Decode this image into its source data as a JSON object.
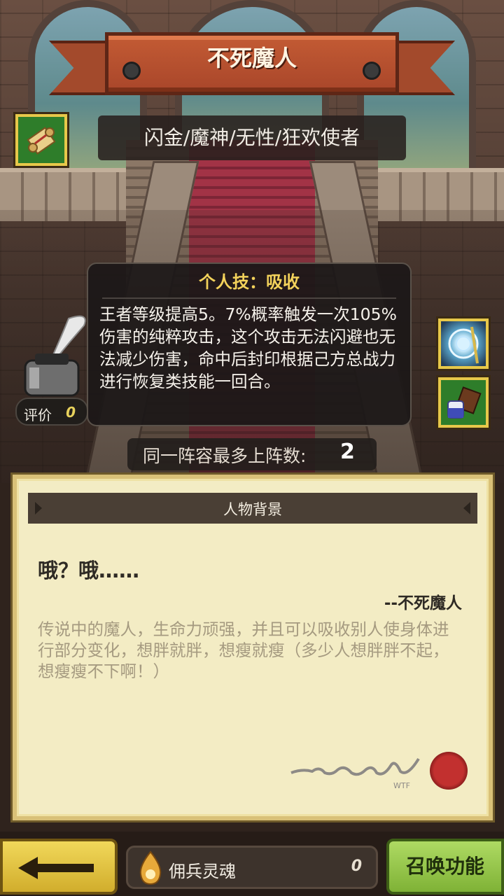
{
  "hero": {
    "name": "不死魔人",
    "tags": "闪金/魔神/无性/狂欢使者"
  },
  "skill": {
    "title": "个人技：吸收",
    "description": "王者等级提高5。7%概率触发一次105%伤害的纯粹攻击，这个攻击无法闪避也无法减少伤害，命中后封印根据己方总战力进行恢复类技能一回合。"
  },
  "rating": {
    "label": "评价",
    "value": "0"
  },
  "team_limit": {
    "label": "同一阵容最多上阵数:",
    "value": "2"
  },
  "background": {
    "tab_title": "人物背景",
    "quote": "哦？哦……",
    "author": "--不死魔人",
    "story": "传说中的魔人，生命力顽强，并且可以吸收别人使身体进行部分变化，想胖就胖，想瘦就瘦（多少人想胖胖不起，想瘦瘦不下啊！）",
    "signature_mark": "WTF"
  },
  "bottom": {
    "soul_label": "佣兵灵魂",
    "soul_count": "0",
    "summon_label": "召唤功能"
  },
  "icons": {
    "scroll": "scroll-icon",
    "magic": "magic-circle-icon",
    "item": "potion-chocolate-icon",
    "ink": "quill-ink-icon",
    "soul": "soul-flame-icon",
    "back": "back-arrow-icon"
  },
  "colors": {
    "skill_title": "#f3d25b",
    "banner": "#b44f2e",
    "summon": "#8fc246",
    "back": "#e3c446"
  }
}
